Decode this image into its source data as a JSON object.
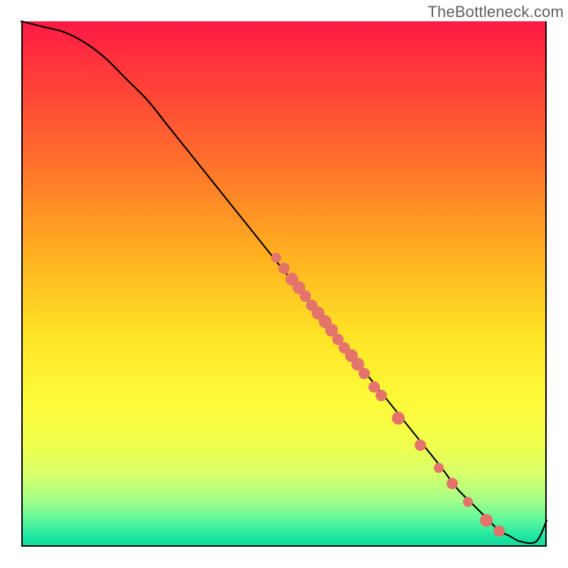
{
  "attribution": "TheBottleneck.com",
  "chart_data": {
    "type": "line",
    "title": "",
    "xlabel": "",
    "ylabel": "",
    "xlim": [
      0,
      100
    ],
    "ylim": [
      0,
      100
    ],
    "background_gradient_top": "#ff1a44",
    "background_gradient_bottom": "#0fd8a0",
    "series": [
      {
        "name": "bottleneck-curve",
        "x": [
          0,
          4,
          8,
          12,
          16,
          20,
          24,
          28,
          32,
          36,
          40,
          44,
          48,
          52,
          56,
          60,
          64,
          68,
          72,
          76,
          80,
          83,
          86,
          89,
          91,
          93,
          95,
          98,
          100
        ],
        "y": [
          100,
          99,
          98,
          96,
          93,
          89,
          85,
          80,
          75,
          70,
          65,
          60,
          55,
          50,
          45,
          40,
          35,
          30,
          25,
          20,
          15,
          11,
          8,
          5,
          3,
          2,
          1,
          1,
          5
        ]
      }
    ],
    "points": {
      "name": "highlighted-points",
      "color": "#e4736b",
      "items": [
        {
          "x": 48.5,
          "y": 55.0,
          "r": 7
        },
        {
          "x": 50.0,
          "y": 53.0,
          "r": 8
        },
        {
          "x": 51.5,
          "y": 51.0,
          "r": 9
        },
        {
          "x": 52.8,
          "y": 49.3,
          "r": 9
        },
        {
          "x": 54.0,
          "y": 47.7,
          "r": 8
        },
        {
          "x": 55.3,
          "y": 46.0,
          "r": 8
        },
        {
          "x": 56.5,
          "y": 44.4,
          "r": 9
        },
        {
          "x": 57.8,
          "y": 42.8,
          "r": 9
        },
        {
          "x": 59.0,
          "y": 41.2,
          "r": 9
        },
        {
          "x": 60.3,
          "y": 39.5,
          "r": 8
        },
        {
          "x": 61.5,
          "y": 37.9,
          "r": 8
        },
        {
          "x": 62.8,
          "y": 36.3,
          "r": 9
        },
        {
          "x": 64.0,
          "y": 34.7,
          "r": 9
        },
        {
          "x": 65.3,
          "y": 33.0,
          "r": 8
        },
        {
          "x": 67.2,
          "y": 30.4,
          "r": 8
        },
        {
          "x": 68.5,
          "y": 28.8,
          "r": 8
        },
        {
          "x": 71.8,
          "y": 24.5,
          "r": 9
        },
        {
          "x": 76.0,
          "y": 19.3,
          "r": 8
        },
        {
          "x": 79.5,
          "y": 15.0,
          "r": 7
        },
        {
          "x": 82.0,
          "y": 12.0,
          "r": 8
        },
        {
          "x": 85.0,
          "y": 8.5,
          "r": 7
        },
        {
          "x": 88.5,
          "y": 5.0,
          "r": 9
        },
        {
          "x": 91.0,
          "y": 3.0,
          "r": 8
        }
      ]
    }
  }
}
